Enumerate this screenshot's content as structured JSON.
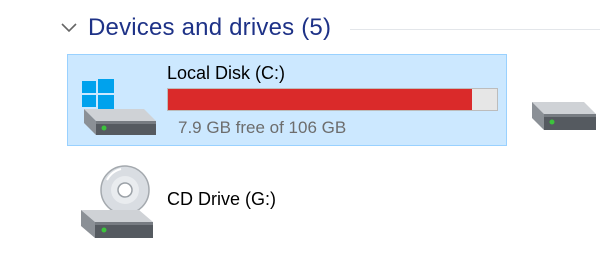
{
  "group": {
    "title": "Devices and drives (5)",
    "expanded": true,
    "icon": "chevron-down-icon"
  },
  "drives": {
    "local_disk": {
      "name": "Local Disk (C:)",
      "space_text": "7.9 GB free of 106 GB",
      "used_fraction": 0.925,
      "bar_color": "#da2a2a",
      "icons": [
        "windows-logo-icon",
        "hard-drive-icon"
      ],
      "selected": true
    },
    "partial_drive": {
      "icon": "hard-drive-icon"
    },
    "cd_drive": {
      "name": "CD Drive (G:)",
      "icons": [
        "optical-disc-icon",
        "drive-icon"
      ]
    }
  },
  "colors": {
    "header_text": "#1e3287",
    "selection_bg": "#cce8ff",
    "selection_border": "#99d1ff",
    "subtext": "#6d6d6d",
    "windows_blue": "#00a2ed",
    "status_led": "#3cc33c"
  }
}
